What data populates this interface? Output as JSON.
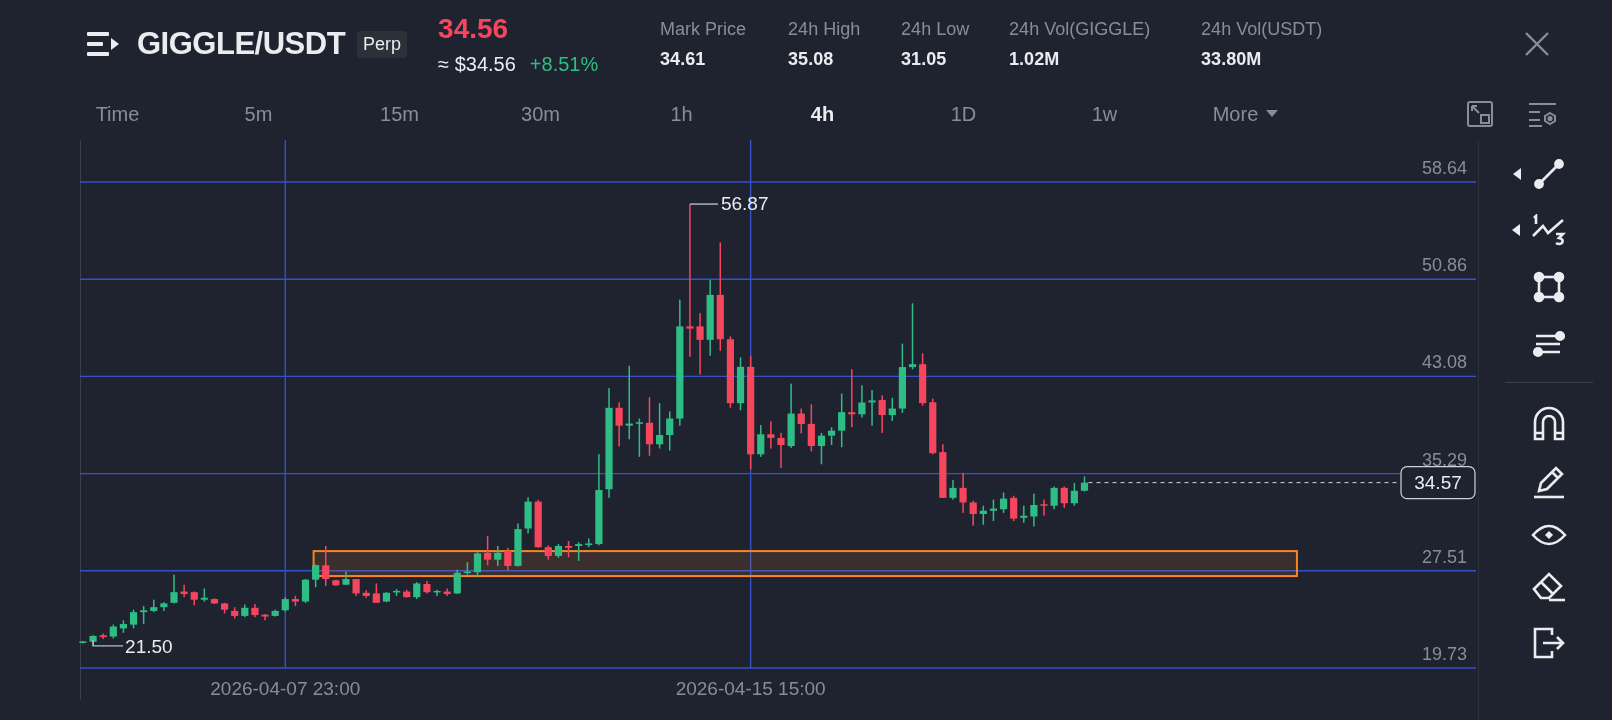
{
  "header": {
    "symbol": "GIGGLE/USDT",
    "contract_tag": "Perp",
    "last_price": "34.56",
    "fiat_price": "≈ $34.56",
    "change": "+8.51%",
    "stats": [
      {
        "label": "Mark Price",
        "value": "34.61"
      },
      {
        "label": "24h High",
        "value": "35.08"
      },
      {
        "label": "24h Low",
        "value": "31.05"
      },
      {
        "label": "24h Vol(GIGGLE)",
        "value": "1.02M"
      },
      {
        "label": "24h Vol(USDT)",
        "value": "33.80M"
      }
    ]
  },
  "intervals": [
    {
      "label": "Time",
      "kind": "interval",
      "selected": false
    },
    {
      "label": "5m",
      "kind": "interval",
      "selected": false
    },
    {
      "label": "15m",
      "kind": "interval",
      "selected": false
    },
    {
      "label": "30m",
      "kind": "interval",
      "selected": false
    },
    {
      "label": "1h",
      "kind": "interval",
      "selected": false
    },
    {
      "label": "4h",
      "kind": "interval",
      "selected": true
    },
    {
      "label": "1D",
      "kind": "interval",
      "selected": false
    },
    {
      "label": "1w",
      "kind": "interval",
      "selected": false
    },
    {
      "label": "More",
      "kind": "menu",
      "selected": false
    }
  ],
  "chart": {
    "price_axis_labels": [
      "58.64",
      "50.86",
      "43.08",
      "35.29",
      "27.51",
      "19.73"
    ],
    "time_axis_labels": [
      "2026-04-07 23:00",
      "2026-04-15 15:00"
    ],
    "high_label": "56.87",
    "low_label": "21.50",
    "last_price_label": "34.57"
  }
}
